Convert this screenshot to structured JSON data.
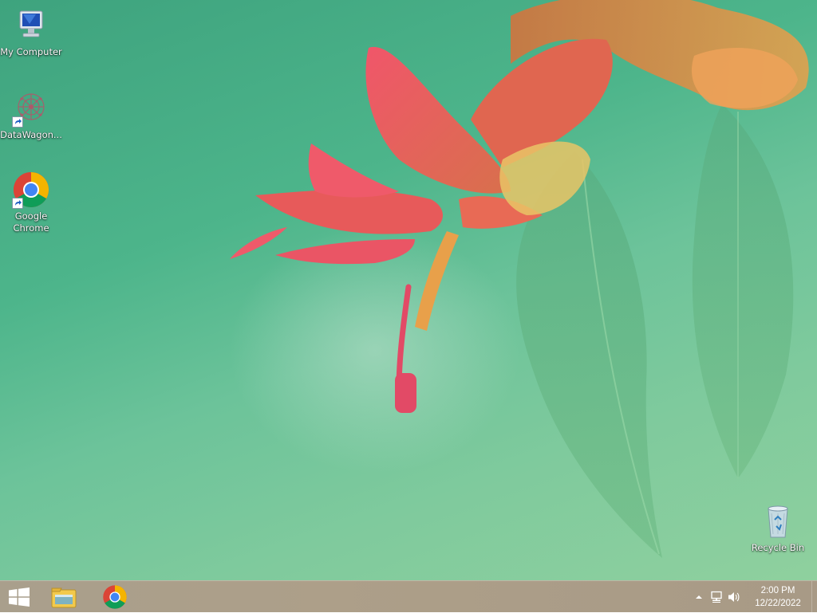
{
  "desktop": {
    "icons": [
      {
        "label": "My Computer",
        "icon": "computer-icon"
      },
      {
        "label": "DataWagon...",
        "icon": "datawagon-app-icon"
      },
      {
        "label": "Google Chrome",
        "icon": "chrome-icon"
      },
      {
        "label": "Recycle Bin",
        "icon": "recycle-bin-icon"
      }
    ]
  },
  "taskbar": {
    "pinned": [
      {
        "name": "start-button",
        "icon": "windows-logo-icon"
      },
      {
        "name": "file-explorer",
        "icon": "folder-icon"
      },
      {
        "name": "google-chrome",
        "icon": "chrome-icon"
      }
    ],
    "tray": {
      "icons": [
        "chevron-up-icon",
        "network-icon",
        "volume-icon"
      ]
    },
    "clock": {
      "time": "2:00 PM",
      "date": "12/22/2022"
    }
  },
  "colors": {
    "taskbar": "#ab9e88",
    "wallpaper_green": "#4db58b",
    "flower_red": "#e8505a"
  }
}
